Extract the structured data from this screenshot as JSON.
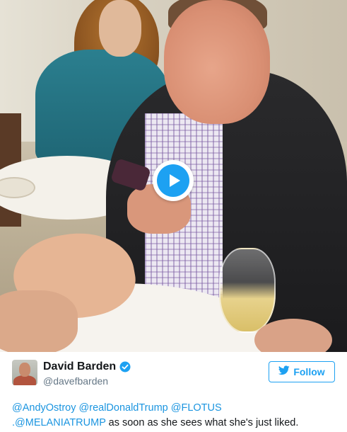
{
  "tweet": {
    "media": {
      "type": "video",
      "play_icon": "play-icon"
    },
    "author": {
      "display_name": "David Barden",
      "handle": "@davefbarden",
      "verified_icon": "verified-badge-icon",
      "avatar_icon": "avatar"
    },
    "follow": {
      "label": "Follow",
      "icon": "twitter-bird-icon"
    },
    "text": {
      "mentions": [
        "@AndyOstroy",
        "@realDonaldTrump",
        "@FLOTUS",
        ".@MELANIATRUMP"
      ],
      "body": " as soon as she sees what she's just liked."
    },
    "colors": {
      "accent": "#1da1f2",
      "link": "#1b95e0",
      "text": "#14171a",
      "muted": "#657786"
    }
  }
}
